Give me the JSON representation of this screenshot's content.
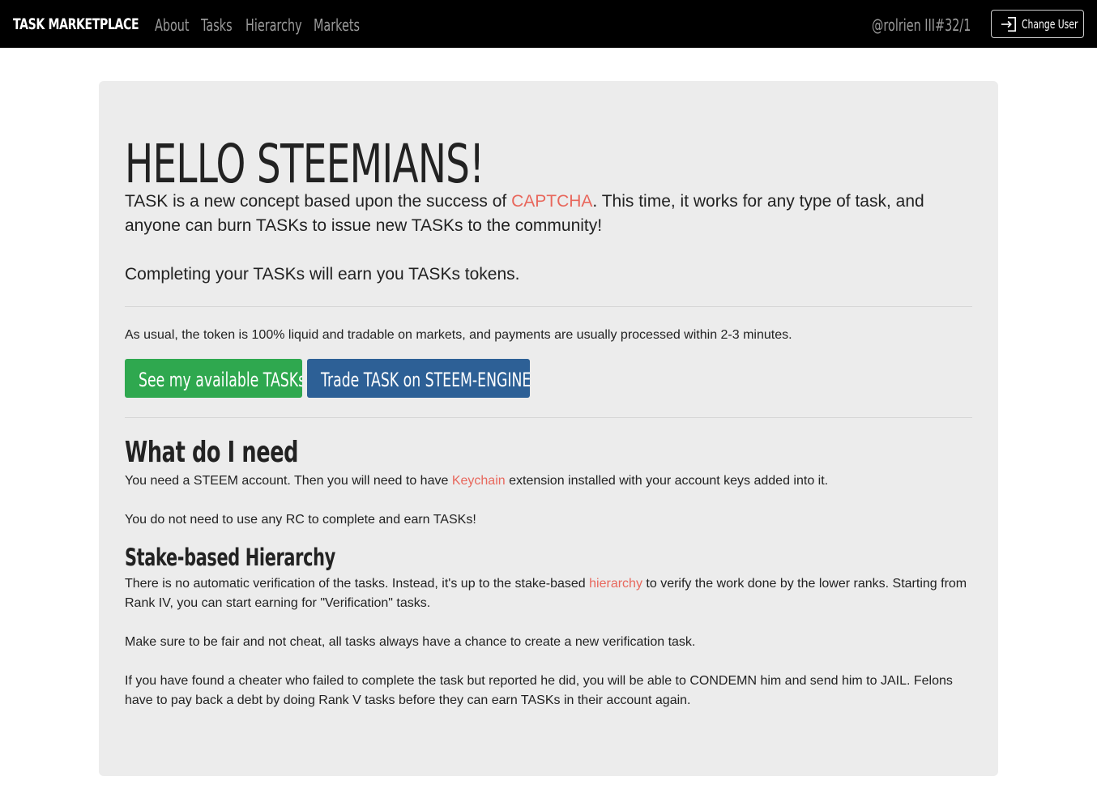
{
  "navbar": {
    "brand": "TASK MARKETPLACE",
    "links": [
      "About",
      "Tasks",
      "Hierarchy",
      "Markets"
    ],
    "user": "@rolrien III#32/1",
    "change_user_label": "Change User",
    "change_user_icon": "login-icon"
  },
  "hero": {
    "title": "HELLO STEEMIANS!",
    "p1_before": "TASK is a new concept based upon the success of ",
    "p1_link": "CAPTCHA",
    "p1_after": ". This time, it works for any type of task, and anyone can burn TASKs to issue new TASKs to the community!",
    "p2": "Completing your TASKs will earn you TASKs tokens.",
    "usual": "As usual, the token is 100% liquid and tradable on markets, and payments are usually processed within 2-3 minutes.",
    "btn_available": "See my available TASKs",
    "btn_trade": "Trade TASK on STEEM-ENGINE"
  },
  "need": {
    "heading": "What do I need",
    "p1_before": "You need a STEEM account. Then you will need to have ",
    "p1_link": "Keychain",
    "p1_after": " extension installed with your account keys added into it.",
    "p2": "You do not need to use any RC to complete and earn TASKs!"
  },
  "stake": {
    "heading": "Stake-based Hierarchy",
    "p1_before": "There is no automatic verification of the tasks. Instead, it's up to the stake-based ",
    "p1_link": "hierarchy",
    "p1_after": " to verify the work done by the lower ranks. Starting from Rank IV, you can start earning for \"Verification\" tasks.",
    "p2": "Make sure to be fair and not cheat, all tasks always have a chance to create a new verification task.",
    "p3": "If you have found a cheater who failed to complete the task but reported he did, you will be able to CONDEMN him and send him to JAIL. Felons have to pay back a debt by doing Rank V tasks before they can earn TASKs in their account again."
  },
  "colors": {
    "navbar_bg": "#000000",
    "link": "#e8675c",
    "btn_green": "#2fa84f",
    "btn_blue": "#2d6096",
    "jumbotron_bg": "#ececec"
  }
}
